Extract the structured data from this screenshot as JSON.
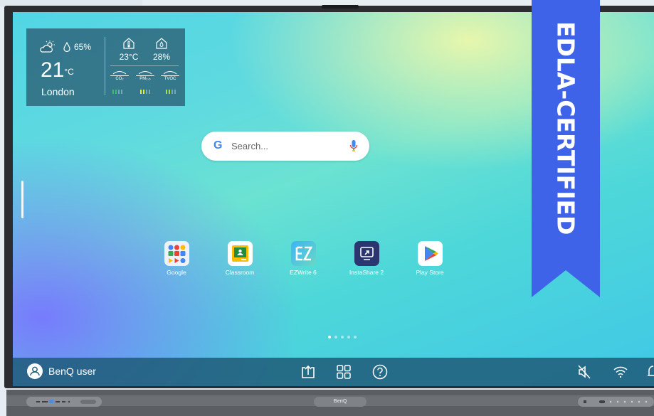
{
  "weather": {
    "humidity": "65%",
    "temperature": "21",
    "temp_unit": "°C",
    "city": "London",
    "indoor_temp": "23°C",
    "indoor_humidity": "28%",
    "sensors": [
      "CO₂",
      "PM₂.₅",
      "TVOC"
    ]
  },
  "search": {
    "placeholder": "Search...",
    "logo": "G"
  },
  "apps": [
    {
      "label": "Google",
      "icon": "google-apps-folder-icon"
    },
    {
      "label": "Classroom",
      "icon": "classroom-icon"
    },
    {
      "label": "EZWrite 6",
      "icon": "ezwrite-icon"
    },
    {
      "label": "InstaShare 2",
      "icon": "instashare-icon"
    },
    {
      "label": "Play Store",
      "icon": "play-store-icon"
    }
  ],
  "page_indicator": {
    "total": 5,
    "current": 1
  },
  "taskbar": {
    "user_name": "BenQ user",
    "icons": [
      "share-screen-icon",
      "apps-grid-icon",
      "help-icon",
      "mute-icon",
      "wifi-icon",
      "notification-icon"
    ]
  },
  "ribbon": {
    "text": "EDLA-CERTIFIED",
    "color": "#3f63e8"
  },
  "bezel": {
    "brand": "BenQ"
  },
  "colors": {
    "google_blue": "#4285f4",
    "google_red": "#ea4335",
    "google_yellow": "#fbbc05",
    "google_green": "#34a853"
  }
}
